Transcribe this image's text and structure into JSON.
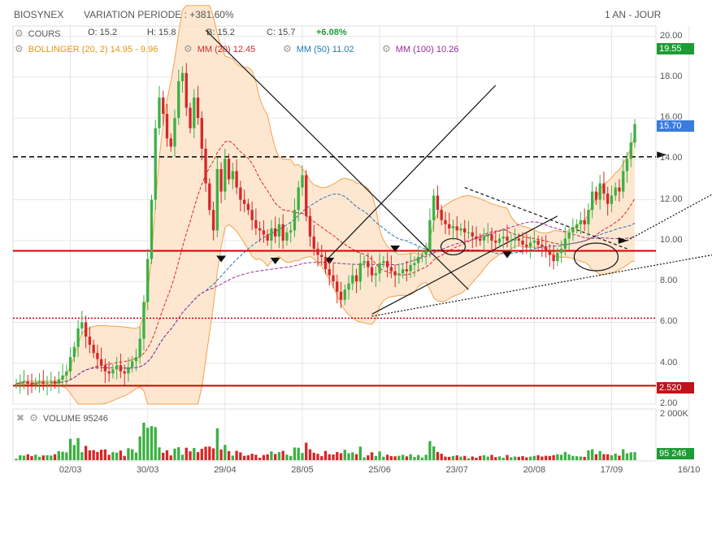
{
  "header": {
    "symbol": "BIOSYNEX",
    "variation": "VARIATION PERIODE : +381.60%",
    "period": "1 AN - JOUR"
  },
  "legend": {
    "cours_label": "COURS",
    "open": "O: 15.2",
    "high": "H: 15.8",
    "low": "B: 15.2",
    "close": "C: 15.7",
    "change": "+6.08%",
    "bollinger": "BOLLINGER (20, 2)  14.95 - 9.96",
    "mm20": "MM (20)  12.45",
    "mm50": "MM (50)  11.02",
    "mm100": "MM (100)  10.26",
    "volume": "VOLUME  95246"
  },
  "tags": {
    "bollinger_upper": "19.55",
    "last_price": "15.70",
    "bollinger_lower": "2.520",
    "last_volume": "95 246"
  },
  "colors": {
    "up": "#3cb043",
    "down": "#d62728",
    "bollinger_fill": "#fde3c9",
    "bollinger_line": "#f5a14a",
    "mm20": "#d62728",
    "mm50": "#1f77b4",
    "mm100": "#9b2a9b",
    "support": "#d40000",
    "tag_green": "#1e9b35",
    "tag_blue": "#3a7be0",
    "tag_red": "#c0141b",
    "change_green": "#1e9b35"
  },
  "chart_data": {
    "type": "line",
    "title": "BIOSYNEX",
    "xlabel": "",
    "ylabel": "",
    "y_ticks": [
      "20.00",
      "18.00",
      "16.00",
      "14.00",
      "12.00",
      "10.00",
      "8.00",
      "6.00",
      "4.00",
      "2.00"
    ],
    "ylim": [
      2,
      20.5
    ],
    "volume_ticks": [
      "2 000K"
    ],
    "x_ticks": [
      "02/03",
      "30/03",
      "29/04",
      "28/05",
      "25/06",
      "23/07",
      "20/08",
      "17/09",
      "16/10"
    ],
    "x_tick_index": [
      14,
      34,
      54,
      74,
      94,
      114,
      134,
      154,
      174
    ],
    "horizontal_levels": [
      {
        "value": 14.1,
        "style": "dashed",
        "color": "#000000"
      },
      {
        "value": 9.5,
        "style": "solid",
        "color": "#d40000"
      },
      {
        "value": 6.2,
        "style": "dotted",
        "color": "#d40000"
      },
      {
        "value": 2.9,
        "style": "solid",
        "color": "#d40000"
      }
    ],
    "close_series": [
      3.0,
      3.05,
      3.1,
      3.0,
      2.95,
      3.05,
      3.1,
      3.0,
      3.05,
      3.1,
      3.0,
      3.2,
      3.4,
      3.6,
      4.3,
      4.8,
      5.7,
      6.0,
      5.3,
      4.9,
      4.5,
      4.2,
      3.9,
      3.6,
      3.5,
      3.7,
      3.9,
      3.6,
      3.5,
      3.8,
      4.1,
      4.3,
      5.2,
      7.0,
      9.1,
      12.0,
      15.5,
      17.0,
      16.2,
      15.0,
      14.6,
      16.0,
      17.8,
      18.2,
      16.5,
      15.5,
      17.0,
      16.0,
      14.5,
      12.8,
      11.5,
      10.5,
      13.5,
      12.4,
      14.0,
      13.0,
      13.4,
      12.6,
      12.0,
      11.8,
      11.5,
      11.0,
      10.6,
      10.5,
      10.3,
      10.0,
      10.6,
      10.2,
      10.8,
      10.0,
      10.4,
      10.5,
      11.5,
      12.6,
      13.2,
      11.2,
      10.2,
      9.6,
      9.3,
      9.2,
      8.6,
      8.3,
      8.0,
      7.5,
      7.1,
      7.6,
      7.9,
      8.3,
      8.0,
      8.9,
      9.0,
      8.7,
      8.3,
      8.4,
      8.9,
      9.0,
      8.7,
      8.5,
      8.3,
      8.4,
      8.6,
      8.5,
      8.8,
      8.9,
      9.2,
      9.3,
      9.5,
      11.0,
      12.2,
      11.5,
      11.0,
      10.8,
      10.6,
      10.7,
      10.5,
      10.6,
      10.4,
      10.4,
      10.2,
      10.1,
      10.0,
      10.2,
      10.3,
      10.0,
      9.9,
      10.1,
      10.2,
      10.0,
      10.0,
      10.1,
      10.0,
      9.8,
      9.7,
      9.9,
      10.0,
      9.8,
      9.7,
      9.5,
      9.3,
      9.0,
      9.4,
      9.6,
      10.1,
      10.4,
      10.6,
      10.8,
      11.0,
      10.8,
      11.5,
      12.4,
      12.0,
      12.8,
      12.3,
      11.8,
      12.2,
      12.6,
      12.4,
      13.4,
      14.0,
      14.8,
      15.7
    ],
    "series": [
      {
        "name": "MM (20)",
        "values": [
          12.45
        ]
      },
      {
        "name": "MM (50)",
        "values": [
          11.02
        ]
      },
      {
        "name": "MM (100)",
        "values": [
          10.26
        ]
      }
    ]
  }
}
